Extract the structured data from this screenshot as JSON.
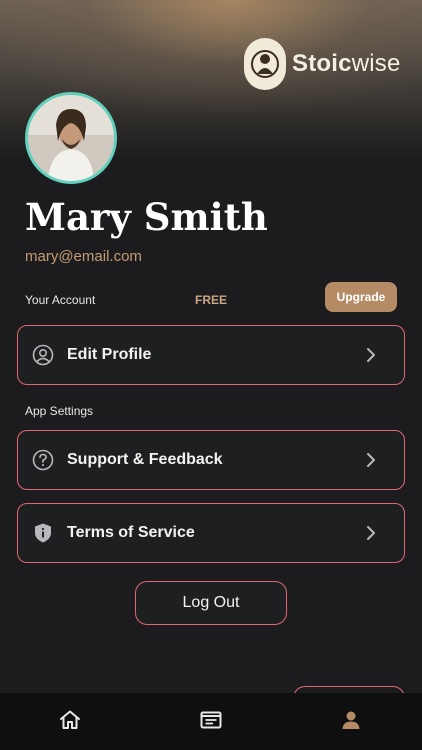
{
  "brand": {
    "name_bold": "Stoic",
    "name_rest": "wise",
    "logo_icon": "bust-medallion-icon"
  },
  "profile": {
    "name": "Mary Smith",
    "email": "mary@email.com"
  },
  "account": {
    "label": "Your Account",
    "plan": "FREE",
    "upgrade_label": "Upgrade"
  },
  "menu": {
    "edit_profile": {
      "label": "Edit Profile",
      "icon": "user-circle-icon"
    },
    "section_app_settings": "App Settings",
    "support": {
      "label": "Support & Feedback",
      "icon": "question-circle-icon"
    },
    "terms": {
      "label": "Terms of Service",
      "icon": "shield-info-icon"
    }
  },
  "logout_label": "Log Out",
  "tabs": [
    {
      "name": "home",
      "icon": "home-icon"
    },
    {
      "name": "journal",
      "icon": "journal-icon"
    },
    {
      "name": "profile",
      "icon": "user-icon",
      "active": true
    }
  ],
  "colors": {
    "accent": "#e06770",
    "brand": "#b58b65",
    "avatar_ring": "#5fd1bd",
    "background": "#1c1c1e"
  }
}
